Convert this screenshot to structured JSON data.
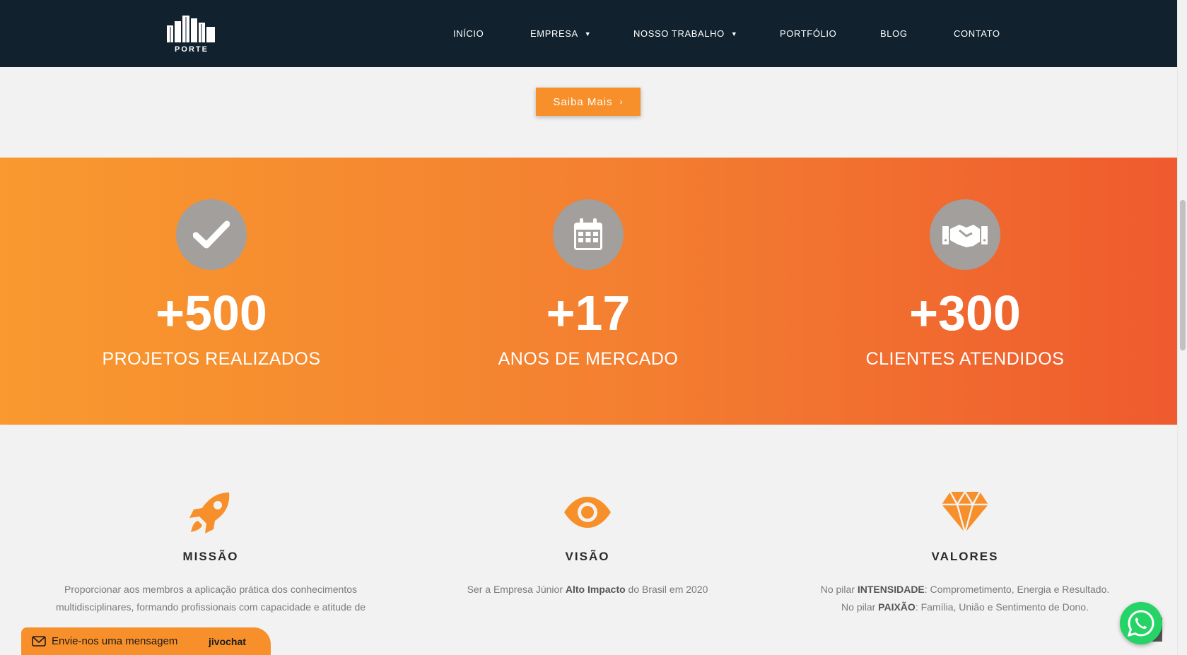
{
  "header": {
    "logo_text": "PORTE",
    "nav": [
      {
        "label": "INÍCIO",
        "has_caret": false
      },
      {
        "label": "EMPRESA",
        "has_caret": true
      },
      {
        "label": "NOSSO TRABALHO",
        "has_caret": true
      },
      {
        "label": "PORTFÓLIO",
        "has_caret": false
      },
      {
        "label": "BLOG",
        "has_caret": false
      },
      {
        "label": "CONTATO",
        "has_caret": false
      }
    ]
  },
  "cta": {
    "label": "Saiba Mais"
  },
  "stats": [
    {
      "icon": "checkmark-icon",
      "value": "+500",
      "label": "PROJETOS REALIZADOS"
    },
    {
      "icon": "calendar-icon",
      "value": "+17",
      "label": "ANOS DE MERCADO"
    },
    {
      "icon": "handshake-icon",
      "value": "+300",
      "label": "CLIENTES ATENDIDOS"
    }
  ],
  "cards": {
    "mission": {
      "icon": "rocket-icon",
      "title": "MISSÃO",
      "line1": "Proporcionar aos membros a aplicação prática dos conhecimentos",
      "line2": "multidisciplinares, formando profissionais com capacidade e atitude de"
    },
    "vision": {
      "icon": "eye-icon",
      "title": "VISÃO",
      "pre": "Ser a Empresa Júnior ",
      "bold": "Alto Impacto",
      "post": " do Brasil em 2020"
    },
    "values": {
      "icon": "diamond-icon",
      "title": "VALORES",
      "l1_pre": "No pilar ",
      "l1_bold": "INTENSIDADE",
      "l1_post": ": Comprometimento, Energia e Resultado.",
      "l2_pre": "No pilar ",
      "l2_bold": "PAIXÃO",
      "l2_post": ": Família, União e Sentimento de Dono."
    }
  },
  "chat": {
    "text": "Envie-nos uma mensagem",
    "brand": "jivochat"
  },
  "colors": {
    "header_bg": "#11212d",
    "accent": "#f7902a",
    "gradient_start": "#f9992f",
    "gradient_end": "#ef5a2e",
    "icon_circle": "#a29f9c"
  }
}
